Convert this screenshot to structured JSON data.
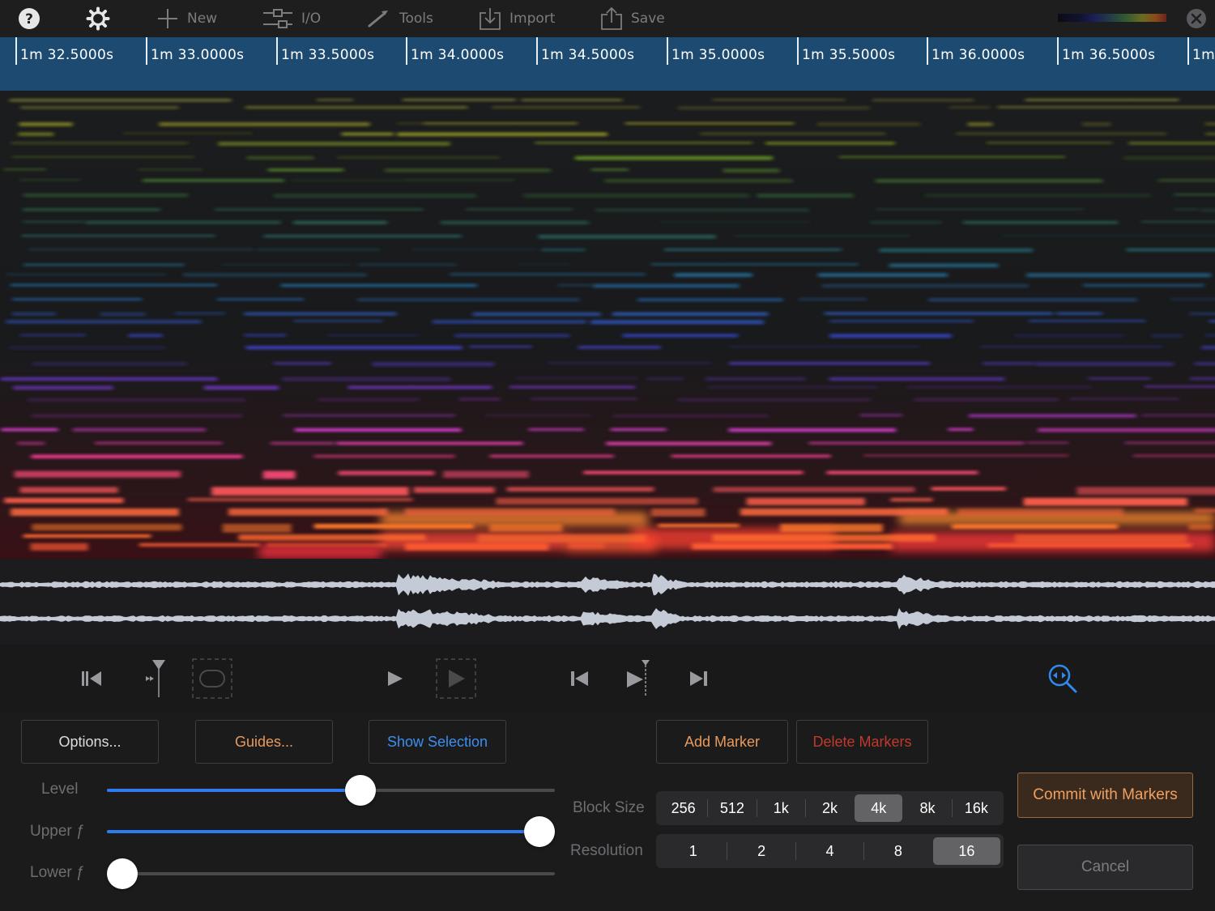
{
  "toolbar": {
    "new_label": "New",
    "io_label": "I/O",
    "tools_label": "Tools",
    "import_label": "Import",
    "save_label": "Save",
    "icons": [
      "help-icon",
      "gear-icon",
      "plus-icon",
      "io-icon",
      "wrench-icon",
      "import-icon",
      "save-icon",
      "close-icon"
    ]
  },
  "ruler": {
    "ticks": [
      "1m 32.5000s",
      "1m 33.0000s",
      "1m 33.5000s",
      "1m 34.0000s",
      "1m 34.5000s",
      "1m 35.0000s",
      "1m 35.5000s",
      "1m 36.0000s",
      "1m 36.5000s",
      "1m"
    ]
  },
  "transport": {
    "icons": [
      "go-to-start-icon",
      "set-start-marker-icon",
      "loop-icon",
      "play-icon",
      "play-selection-icon",
      "previous-marker-icon",
      "play-from-marker-icon",
      "next-marker-icon",
      "zoom-fit-icon"
    ]
  },
  "controls": {
    "options_label": "Options...",
    "guides_label": "Guides...",
    "show_selection_label": "Show Selection",
    "add_marker_label": "Add Marker",
    "delete_markers_label": "Delete Markers",
    "commit_label": "Commit with Markers",
    "cancel_label": "Cancel",
    "level_label": "Level",
    "upper_label": "Upper ƒ",
    "lower_label": "Lower ƒ",
    "level_value": 0.57,
    "upper_value": 1.0,
    "lower_value": 0.0,
    "block_size_label": "Block Size",
    "block_sizes": [
      "256",
      "512",
      "1k",
      "2k",
      "4k",
      "8k",
      "16k"
    ],
    "block_size_selected": "4k",
    "resolution_label": "Resolution",
    "resolutions": [
      "1",
      "2",
      "4",
      "8",
      "16"
    ],
    "resolution_selected": "16"
  },
  "colors": {
    "accent_blue": "#2f7bf0",
    "ruler_bg": "#1d4a70",
    "guides_orange": "#e89a5c",
    "delete_red": "#c0392b",
    "commit_bg": "#3a2a1e",
    "commit_text": "#f0a060"
  }
}
